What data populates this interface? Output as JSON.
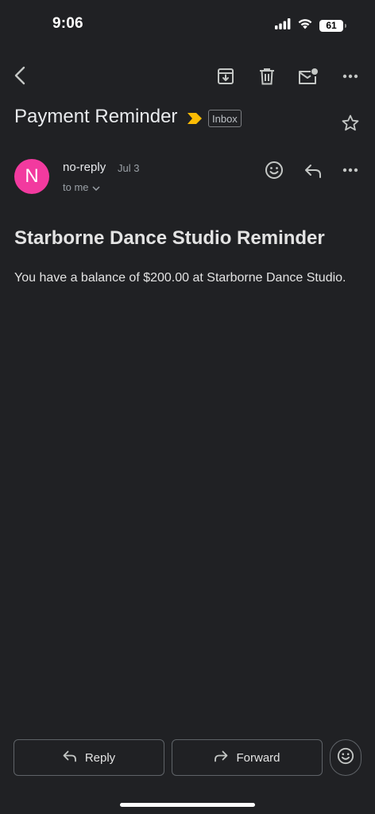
{
  "status_bar": {
    "time": "9:06",
    "battery_level": "61",
    "icons": [
      "signal-icon",
      "wifi-icon",
      "battery-icon"
    ]
  },
  "toolbar": {
    "icons": [
      "back-icon",
      "archive-icon",
      "delete-icon",
      "mark-unread-icon",
      "more-icon"
    ]
  },
  "email": {
    "subject": "Payment Reminder",
    "label": "Inbox",
    "important_marker_color": "#fbbc04",
    "sender": {
      "avatar_letter": "N",
      "avatar_color": "#f23a9f",
      "name": "no-reply",
      "date": "Jul 3",
      "recipient": "to me"
    },
    "body": {
      "heading": "Starborne Dance Studio Reminder",
      "text": "You have a balance of $200.00 at Starborne Dance Studio."
    }
  },
  "actions": {
    "reply_label": "Reply",
    "forward_label": "Forward"
  }
}
